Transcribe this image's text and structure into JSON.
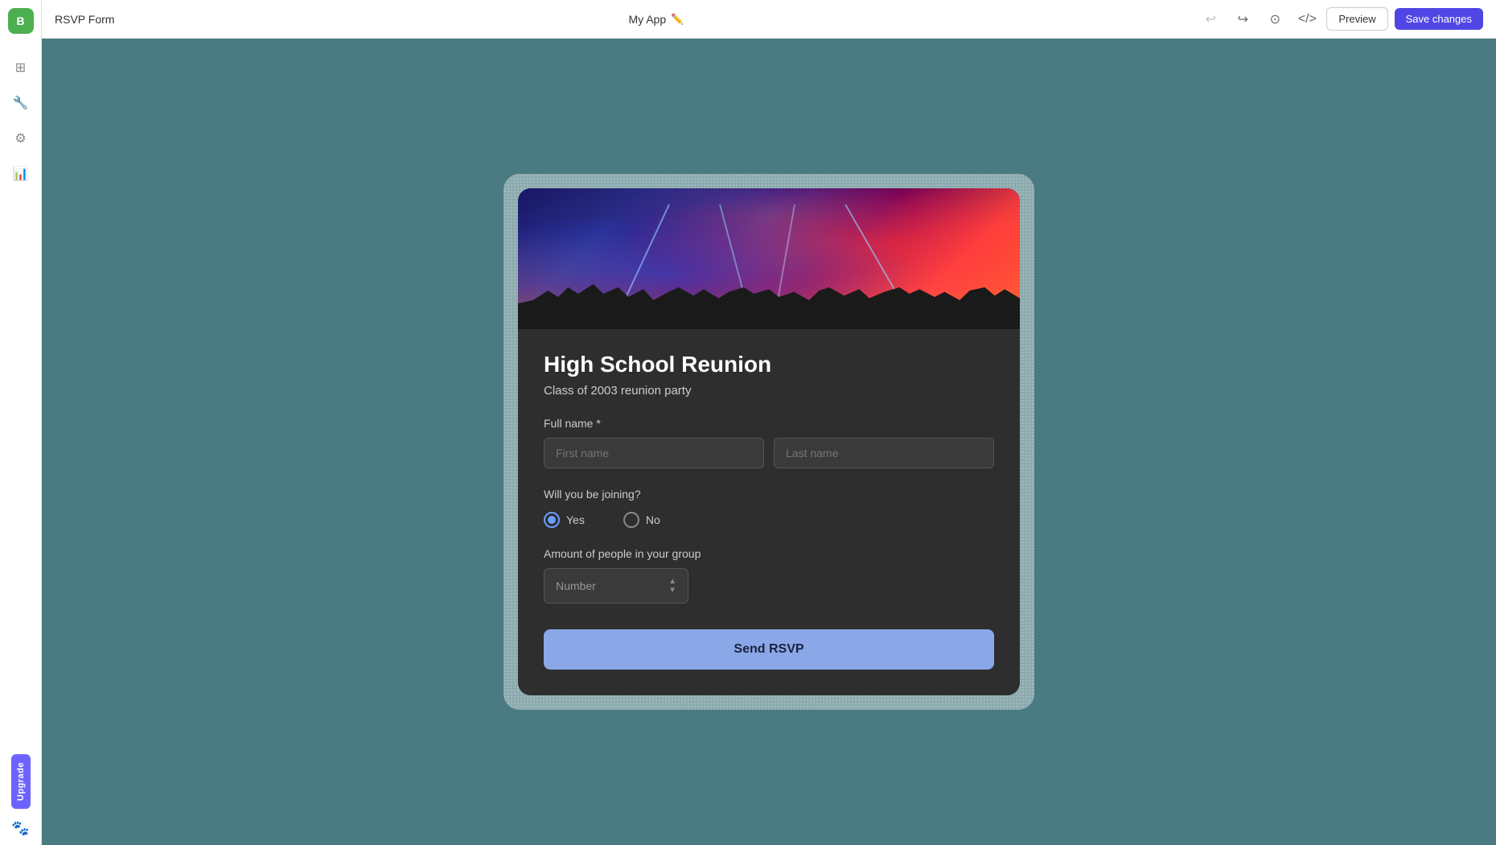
{
  "topbar": {
    "title": "RSVP Form",
    "app_name": "My App",
    "edit_icon": "✏️",
    "preview_label": "Preview",
    "save_label": "Save changes"
  },
  "sidebar": {
    "logo_text": "B",
    "items": [
      {
        "icon": "⊞",
        "name": "grid"
      },
      {
        "icon": "🔧",
        "name": "tools"
      },
      {
        "icon": "⚙",
        "name": "settings"
      },
      {
        "icon": "📊",
        "name": "analytics"
      }
    ],
    "upgrade_label": "Upgrade",
    "paw_icon": "🐾"
  },
  "form": {
    "title": "High School Reunion",
    "subtitle": "Class of 2003 reunion party",
    "full_name_label": "Full name *",
    "first_name_placeholder": "First name",
    "last_name_placeholder": "Last name",
    "joining_label": "Will you be joining?",
    "yes_label": "Yes",
    "no_label": "No",
    "amount_label": "Amount of people in your group",
    "number_placeholder": "Number",
    "send_label": "Send RSVP"
  }
}
